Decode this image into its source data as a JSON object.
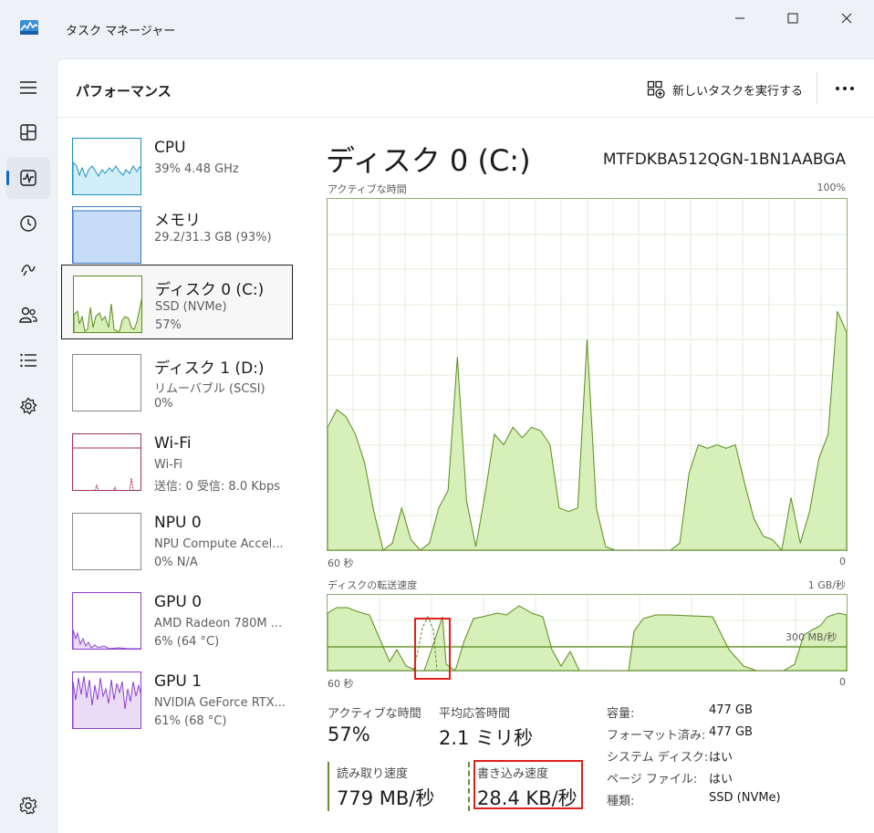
{
  "window": {
    "title": "タスク マネージャー",
    "accent": "#0f6cbd"
  },
  "nav": {
    "items": [
      "hamburger-icon",
      "processes-icon",
      "performance-icon",
      "app-history-icon",
      "startup-apps-icon",
      "users-icon",
      "details-icon",
      "services-icon",
      "settings-icon"
    ],
    "active": "performance-icon"
  },
  "header": {
    "title": "パフォーマンス",
    "run_task_label": "新しいタスクを実行する"
  },
  "devices": [
    {
      "name": "CPU",
      "line1": "39% 4.48 GHz",
      "line2": ""
    },
    {
      "name": "メモリ",
      "line1": "29.2/31.3 GB (93%)",
      "line2": ""
    },
    {
      "name": "ディスク 0 (C:)",
      "line1": "SSD (NVMe)",
      "line2": "57%"
    },
    {
      "name": "ディスク 1 (D:)",
      "line1": "リムーバブル (SCSI)",
      "line2": "0%"
    },
    {
      "name": "Wi-Fi",
      "line1": "Wi-Fi",
      "line2": "送信: 0 受信: 8.0 Kbps"
    },
    {
      "name": "NPU 0",
      "line1": "NPU Compute Accel...",
      "line2": "0% N/A"
    },
    {
      "name": "GPU 0",
      "line1": "AMD Radeon 780M ...",
      "line2": "6% (64 °C)"
    },
    {
      "name": "GPU 1",
      "line1": "NVIDIA GeForce RTX...",
      "line2": "61% (68 °C)"
    }
  ],
  "detail": {
    "title": "ディスク 0 (C:)",
    "model": "MTFDKBA512QGN-1BN1AABGA",
    "active_graph": {
      "label": "アクティブな時間",
      "max_label": "100%",
      "time_left": "60 秒",
      "time_right": "0"
    },
    "transfer_graph": {
      "label": "ディスクの転送速度",
      "max_label": "1 GB/秒",
      "ref_label": "300 MB/秒",
      "time_left": "60 秒",
      "time_right": "0"
    },
    "stats": {
      "active_time_label": "アクティブな時間",
      "active_time_value": "57%",
      "avg_response_label": "平均応答時間",
      "avg_response_value": "2.1 ミリ秒",
      "read_label": "読み取り速度",
      "read_value": "779 MB/秒",
      "write_label": "書き込み速度",
      "write_value": "28.4 KB/秒"
    },
    "specs": [
      {
        "key": "容量:",
        "value": "477 GB"
      },
      {
        "key": "フォーマット済み:",
        "value": "477 GB"
      },
      {
        "key": "システム ディスク:",
        "value": "はい"
      },
      {
        "key": "ページ ファイル:",
        "value": "はい"
      },
      {
        "key": "種類:",
        "value": "SSD (NVMe)"
      }
    ]
  },
  "colors": {
    "disk_line": "#5c8a1e",
    "disk_fill": "#d7efb8",
    "cpu_line": "#1a8fbf",
    "cpu_fill": "#d2eef9",
    "mem_fill": "#c7ddf7",
    "gpu_line": "#8c3fcf",
    "gpu_fill": "#eadcf7",
    "wifi_line": "#a0334f",
    "highlight": "#e0201b"
  },
  "chart_data": [
    {
      "type": "area",
      "title": "アクティブな時間",
      "x_range": [
        60,
        0
      ],
      "ylim": [
        0,
        100
      ],
      "series": [
        {
          "values": [
            35,
            40,
            38,
            33,
            25,
            11,
            0,
            2,
            12,
            3,
            0,
            2,
            12,
            17,
            55,
            14,
            1,
            16,
            33,
            30,
            35,
            32,
            35,
            34,
            30,
            12,
            11,
            12,
            60,
            12,
            1,
            0,
            0,
            0,
            0,
            0,
            0,
            0,
            2,
            22,
            30,
            29,
            30,
            29,
            30,
            19,
            9,
            4,
            3,
            0,
            15,
            2,
            11,
            26,
            33,
            68,
            62
          ]
        }
      ]
    }
  ]
}
